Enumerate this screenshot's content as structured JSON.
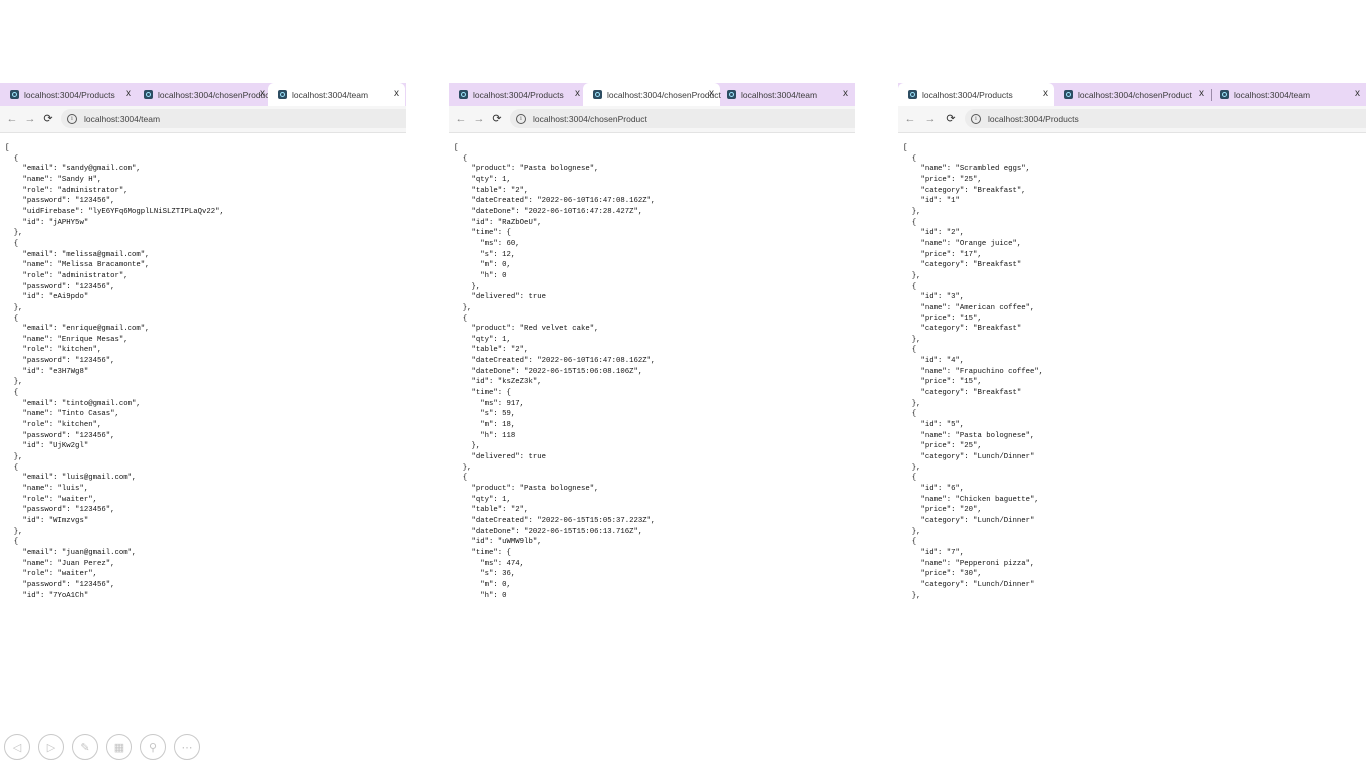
{
  "windows": [
    {
      "tabs": [
        {
          "label": "localhost:3004/Products",
          "active": false
        },
        {
          "label": "localhost:3004/chosenProduct",
          "active": false
        },
        {
          "label": "localhost:3004/team",
          "active": true
        }
      ],
      "url": "localhost:3004/team",
      "content": "[\n  {\n    \"email\": \"sandy@gmail.com\",\n    \"name\": \"Sandy H\",\n    \"role\": \"administrator\",\n    \"password\": \"123456\",\n    \"uidFirebase\": \"lyE6YFq6MogplLNiSLZTIPLaQv22\",\n    \"id\": \"jAPHY5w\"\n  },\n  {\n    \"email\": \"melissa@gmail.com\",\n    \"name\": \"Melissa Bracamonte\",\n    \"role\": \"administrator\",\n    \"password\": \"123456\",\n    \"id\": \"eAi9pdo\"\n  },\n  {\n    \"email\": \"enrique@gmail.com\",\n    \"name\": \"Enrique Mesas\",\n    \"role\": \"kitchen\",\n    \"password\": \"123456\",\n    \"id\": \"e3H7Wg8\"\n  },\n  {\n    \"email\": \"tinto@gmail.com\",\n    \"name\": \"Tinto Casas\",\n    \"role\": \"kitchen\",\n    \"password\": \"123456\",\n    \"id\": \"UjKw2gl\"\n  },\n  {\n    \"email\": \"luis@gmail.com\",\n    \"name\": \"luis\",\n    \"role\": \"waiter\",\n    \"password\": \"123456\",\n    \"id\": \"WImzvgs\"\n  },\n  {\n    \"email\": \"juan@gmail.com\",\n    \"name\": \"Juan Perez\",\n    \"role\": \"waiter\",\n    \"password\": \"123456\",\n    \"id\": \"7YoA1Ch\""
    },
    {
      "tabs": [
        {
          "label": "localhost:3004/Products",
          "active": false
        },
        {
          "label": "localhost:3004/chosenProduct",
          "active": true
        },
        {
          "label": "localhost:3004/team",
          "active": false
        }
      ],
      "url": "localhost:3004/chosenProduct",
      "content": "[\n  {\n    \"product\": \"Pasta bolognese\",\n    \"qty\": 1,\n    \"table\": \"2\",\n    \"dateCreated\": \"2022-06-10T16:47:08.162Z\",\n    \"dateDone\": \"2022-06-10T16:47:28.427Z\",\n    \"id\": \"RaZbOeU\",\n    \"time\": {\n      \"ms\": 60,\n      \"s\": 12,\n      \"m\": 0,\n      \"h\": 0\n    },\n    \"delivered\": true\n  },\n  {\n    \"product\": \"Red velvet cake\",\n    \"qty\": 1,\n    \"table\": \"2\",\n    \"dateCreated\": \"2022-06-10T16:47:08.162Z\",\n    \"dateDone\": \"2022-06-15T15:06:08.106Z\",\n    \"id\": \"ksZeZ3k\",\n    \"time\": {\n      \"ms\": 917,\n      \"s\": 59,\n      \"m\": 18,\n      \"h\": 118\n    },\n    \"delivered\": true\n  },\n  {\n    \"product\": \"Pasta bolognese\",\n    \"qty\": 1,\n    \"table\": \"2\",\n    \"dateCreated\": \"2022-06-15T15:05:37.223Z\",\n    \"dateDone\": \"2022-06-15T15:06:13.716Z\",\n    \"id\": \"uWMW9lb\",\n    \"time\": {\n      \"ms\": 474,\n      \"s\": 36,\n      \"m\": 0,\n      \"h\": 0"
    },
    {
      "tabs": [
        {
          "label": "localhost:3004/Products",
          "active": true
        },
        {
          "label": "localhost:3004/chosenProduct",
          "active": false
        },
        {
          "label": "localhost:3004/team",
          "active": false
        }
      ],
      "url": "localhost:3004/Products",
      "content": "[\n  {\n    \"name\": \"Scrambled eggs\",\n    \"price\": \"25\",\n    \"category\": \"Breakfast\",\n    \"id\": \"1\"\n  },\n  {\n    \"id\": \"2\",\n    \"name\": \"Orange juice\",\n    \"price\": \"17\",\n    \"category\": \"Breakfast\"\n  },\n  {\n    \"id\": \"3\",\n    \"name\": \"American coffee\",\n    \"price\": \"15\",\n    \"category\": \"Breakfast\"\n  },\n  {\n    \"id\": \"4\",\n    \"name\": \"Frapuchino coffee\",\n    \"price\": \"15\",\n    \"category\": \"Breakfast\"\n  },\n  {\n    \"id\": \"5\",\n    \"name\": \"Pasta bolognese\",\n    \"price\": \"25\",\n    \"category\": \"Lunch/Dinner\"\n  },\n  {\n    \"id\": \"6\",\n    \"name\": \"Chicken baguette\",\n    \"price\": \"20\",\n    \"category\": \"Lunch/Dinner\"\n  },\n  {\n    \"id\": \"7\",\n    \"name\": \"Pepperoni pizza\",\n    \"price\": \"30\",\n    \"category\": \"Lunch/Dinner\"\n  },"
    }
  ],
  "toolbar_icons": {
    "back": "←",
    "forward": "→",
    "reload": "⟳",
    "info": "i",
    "close": "x"
  },
  "bottom_controls": [
    {
      "name": "previous-slide-icon",
      "glyph": "◁"
    },
    {
      "name": "next-slide-icon",
      "glyph": "▷"
    },
    {
      "name": "pen-icon",
      "glyph": "✎"
    },
    {
      "name": "grid-icon",
      "glyph": "▦"
    },
    {
      "name": "zoom-icon",
      "glyph": "⚲"
    },
    {
      "name": "more-icon",
      "glyph": "⋯"
    }
  ]
}
